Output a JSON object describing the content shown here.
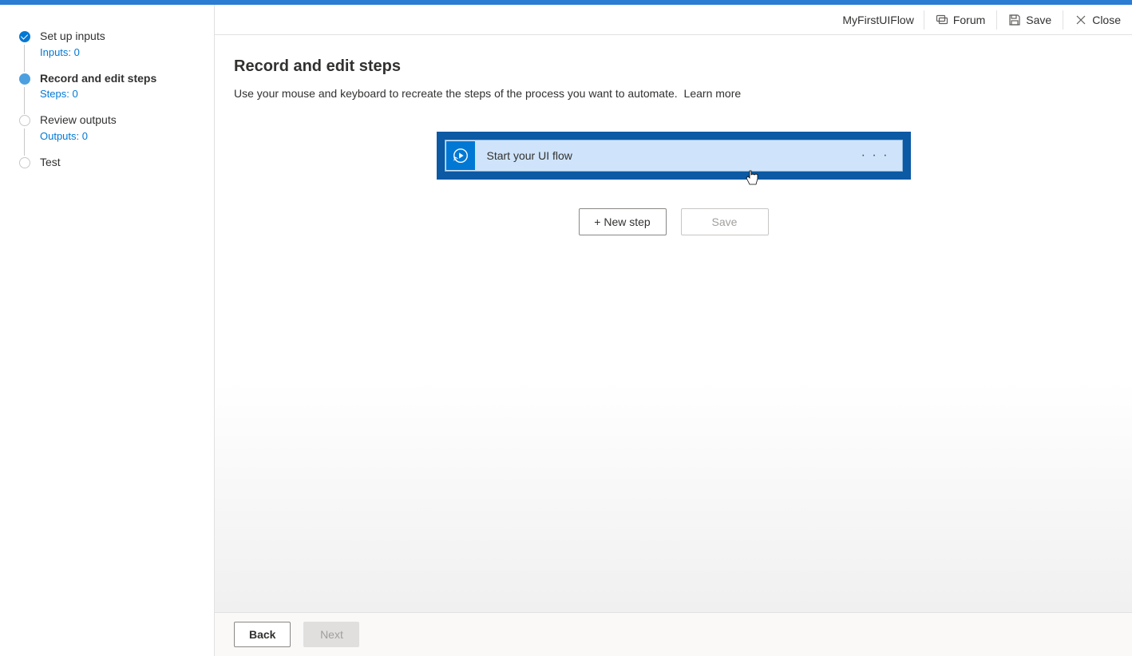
{
  "topbar": {
    "title": "MyFirstUIFlow",
    "forum_label": "Forum",
    "save_label": "Save",
    "close_label": "Close"
  },
  "sidebar": {
    "steps": [
      {
        "title": "Set up inputs",
        "sub": "Inputs: 0",
        "state": "complete",
        "has_sub": true,
        "has_line": true
      },
      {
        "title": "Record and edit steps",
        "sub": "Steps: 0",
        "state": "current",
        "has_sub": true,
        "has_line": true
      },
      {
        "title": "Review outputs",
        "sub": "Outputs: 0",
        "state": "pending",
        "has_sub": true,
        "has_line": true
      },
      {
        "title": "Test",
        "sub": "",
        "state": "pending",
        "has_sub": false,
        "has_line": false
      }
    ]
  },
  "main": {
    "title": "Record and edit steps",
    "description_text": "Use your mouse and keyboard to recreate the steps of the process you want to automate.",
    "learn_more": "Learn more",
    "flow_card_label": "Start your UI flow",
    "new_step_label": "+ New step",
    "save_label": "Save"
  },
  "footer": {
    "back_label": "Back",
    "next_label": "Next"
  }
}
